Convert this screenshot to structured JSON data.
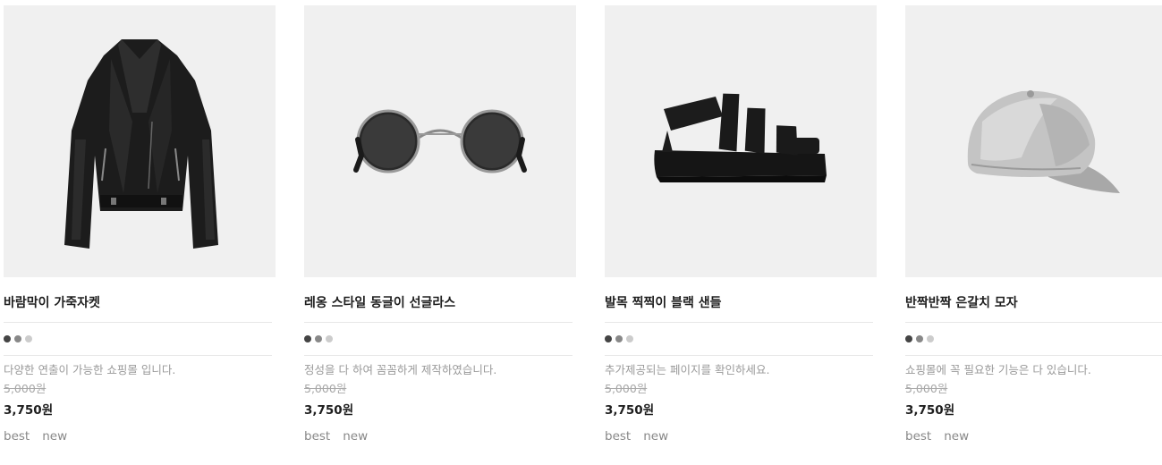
{
  "products": [
    {
      "name": "바람막이 가죽자켓",
      "image_icon": "leather-jacket-icon",
      "swatches": [
        "#444444",
        "#888888",
        "#cccccc"
      ],
      "description": "다양한 연출이 가능한 쇼핑몰 입니다.",
      "original_price": "5,000원",
      "price": "3,750원",
      "tags": [
        "best",
        "new"
      ]
    },
    {
      "name": "레옹 스타일 동글이 선글라스",
      "image_icon": "sunglasses-icon",
      "swatches": [
        "#444444",
        "#888888",
        "#cccccc"
      ],
      "description": "정성을 다 하여 꼼꼼하게 제작하였습니다.",
      "original_price": "5,000원",
      "price": "3,750원",
      "tags": [
        "best",
        "new"
      ]
    },
    {
      "name": "발목 찍찍이 블랙 샌들",
      "image_icon": "sandal-icon",
      "swatches": [
        "#444444",
        "#888888",
        "#cccccc"
      ],
      "description": "추가제공되는 페이지를 확인하세요.",
      "original_price": "5,000원",
      "price": "3,750원",
      "tags": [
        "best",
        "new"
      ]
    },
    {
      "name": "반짝반짝 은갈치 모자",
      "image_icon": "cap-icon",
      "swatches": [
        "#444444",
        "#888888",
        "#cccccc"
      ],
      "description": "쇼핑몰에 꼭 필요한 기능은 다 있습니다.",
      "original_price": "5,000원",
      "price": "3,750원",
      "tags": [
        "best",
        "new"
      ]
    }
  ]
}
